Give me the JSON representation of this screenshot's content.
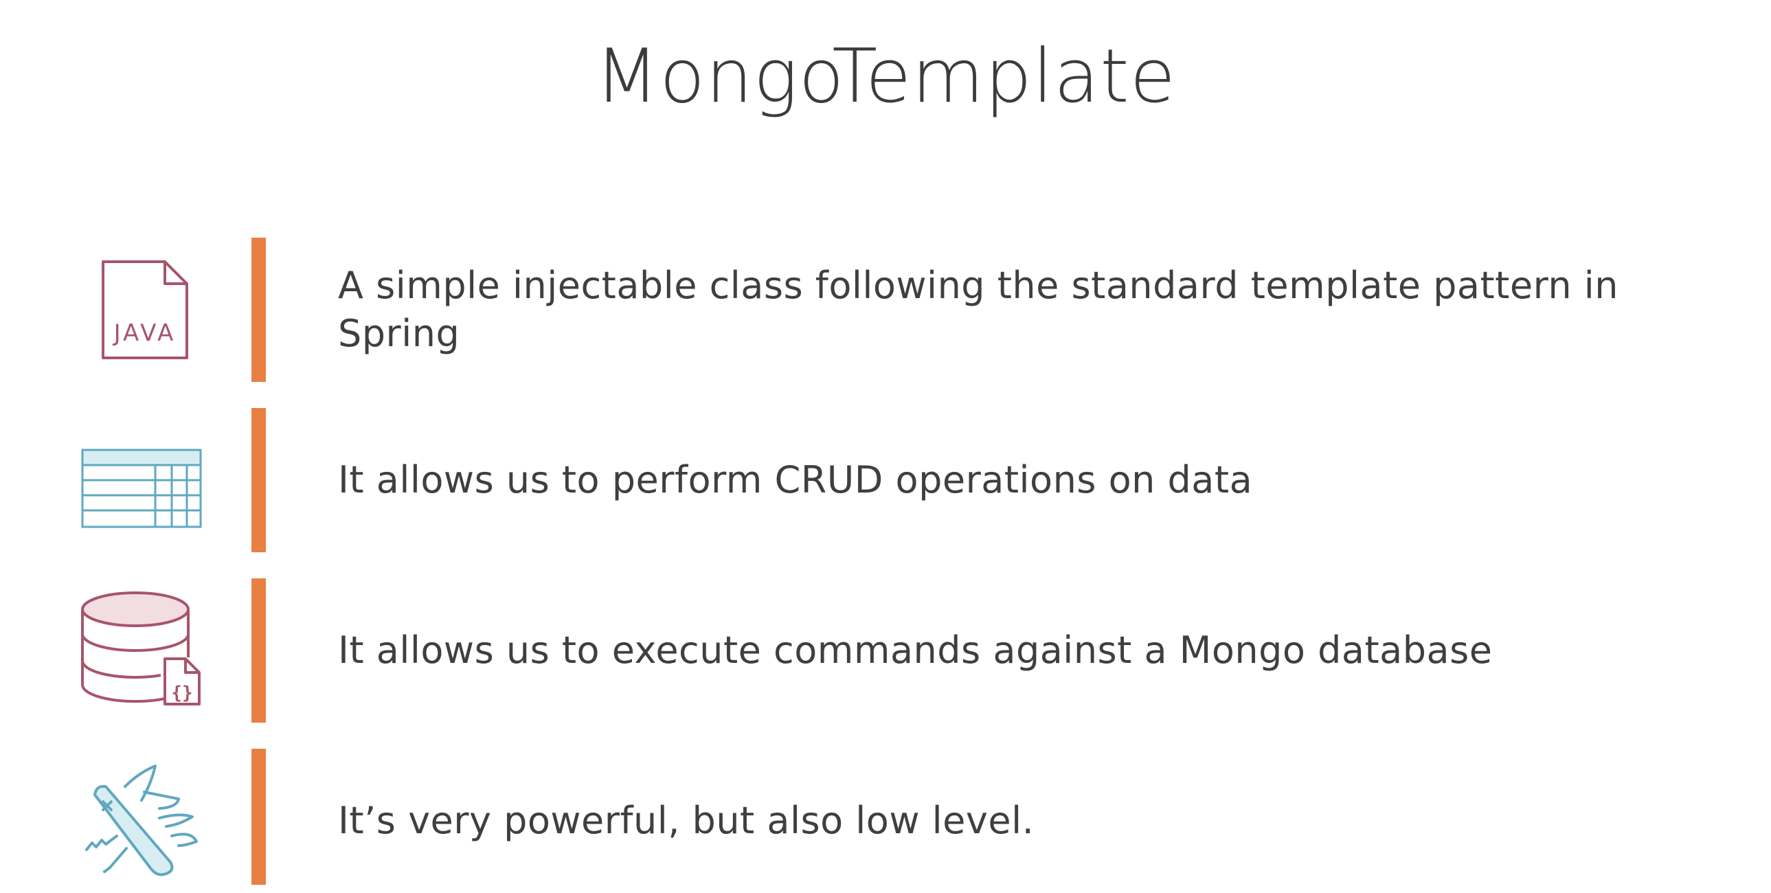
{
  "slide": {
    "title": "MongoTemplate",
    "accent_color": "#e87f43",
    "items": [
      {
        "icon": "java-file-icon",
        "text": "A simple injectable class following the standard template pattern in Spring"
      },
      {
        "icon": "table-icon",
        "text": "It allows us to perform CRUD operations on data"
      },
      {
        "icon": "database-document-icon",
        "text": "It allows us to execute commands against a Mongo database"
      },
      {
        "icon": "swiss-army-knife-icon",
        "text": "It’s very powerful, but also low level."
      }
    ],
    "icon_labels": {
      "java": "JAVA",
      "document": "{}"
    }
  }
}
